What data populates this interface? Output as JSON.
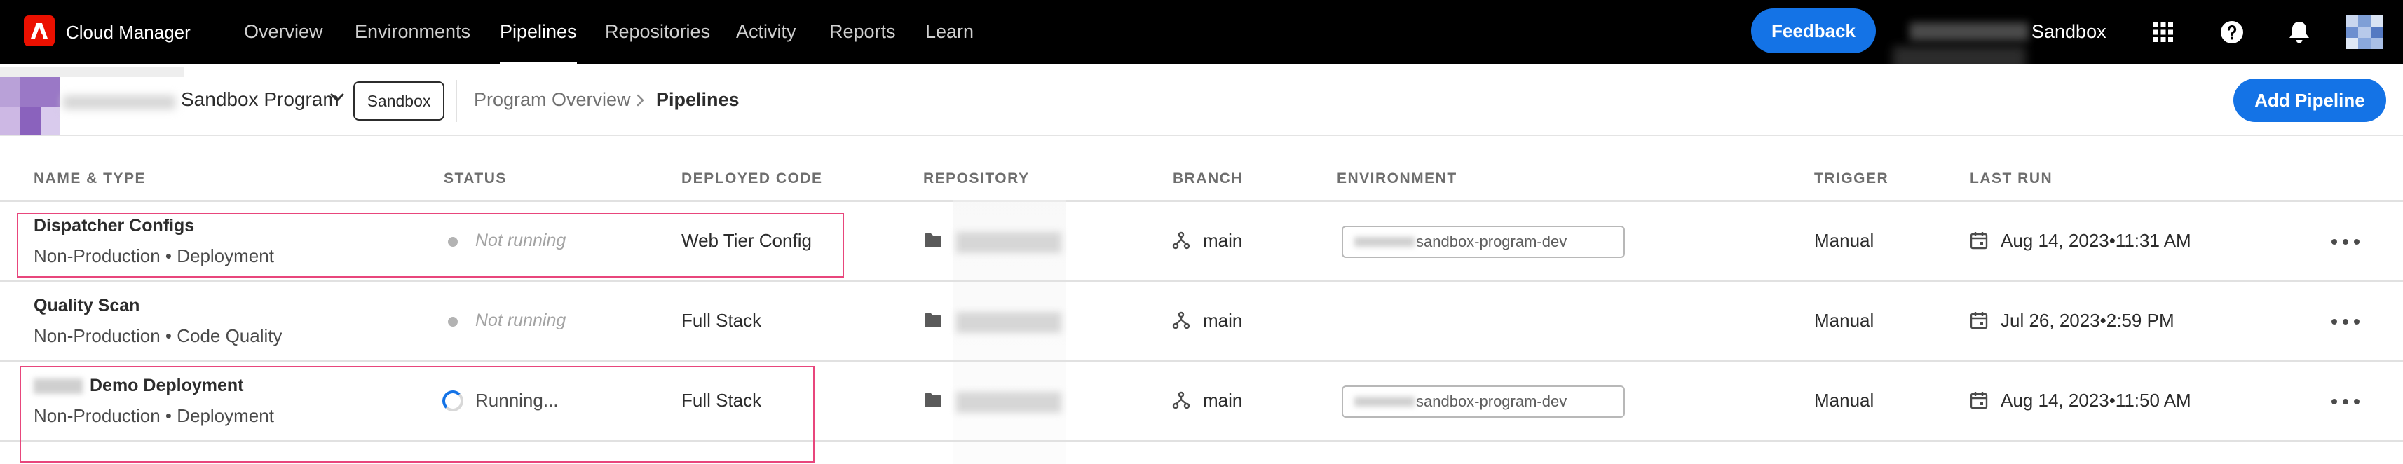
{
  "topbar": {
    "app_title": "Cloud Manager",
    "nav": [
      "Overview",
      "Environments",
      "Pipelines",
      "Repositories",
      "Activity",
      "Reports",
      "Learn"
    ],
    "active_nav": "Pipelines",
    "feedback_label": "Feedback",
    "org_name": "Sandbox",
    "icons": [
      "apps-grid-icon",
      "help-icon",
      "bell-icon",
      "user-avatar"
    ]
  },
  "programbar": {
    "program_name": "Sandbox Program",
    "program_badge": "Sandbox",
    "breadcrumb": [
      "Program Overview",
      "Pipelines"
    ],
    "add_label": "Add Pipeline"
  },
  "table": {
    "columns": [
      "NAME & TYPE",
      "STATUS",
      "DEPLOYED CODE",
      "REPOSITORY",
      "BRANCH",
      "ENVIRONMENT",
      "TRIGGER",
      "LAST RUN"
    ],
    "rows": [
      {
        "name": "Dispatcher Configs",
        "type": "Non-Production • Deployment",
        "status": "Not running",
        "status_state": "idle",
        "deployed_code": "Web Tier Config",
        "branch": "main",
        "environment": "sandbox-program-dev",
        "trigger": "Manual",
        "last_run": "Aug 14, 2023•11:31 AM",
        "highlighted": true
      },
      {
        "name": "Quality Scan",
        "type": "Non-Production • Code Quality",
        "status": "Not running",
        "status_state": "idle",
        "deployed_code": "Full Stack",
        "branch": "main",
        "environment": "",
        "trigger": "Manual",
        "last_run": "Jul 26, 2023•2:59 PM",
        "highlighted": false
      },
      {
        "name": "Demo Deployment",
        "type": "Non-Production • Deployment",
        "status": "Running...",
        "status_state": "running",
        "deployed_code": "Full Stack",
        "branch": "main",
        "environment": "sandbox-program-dev",
        "trigger": "Manual",
        "last_run": "Aug 14, 2023•11:50 AM",
        "highlighted": true
      }
    ]
  },
  "colors": {
    "accent": "#1473e6",
    "brand": "#eb1000",
    "highlight": "#e8467c",
    "topbar": "#000000"
  }
}
